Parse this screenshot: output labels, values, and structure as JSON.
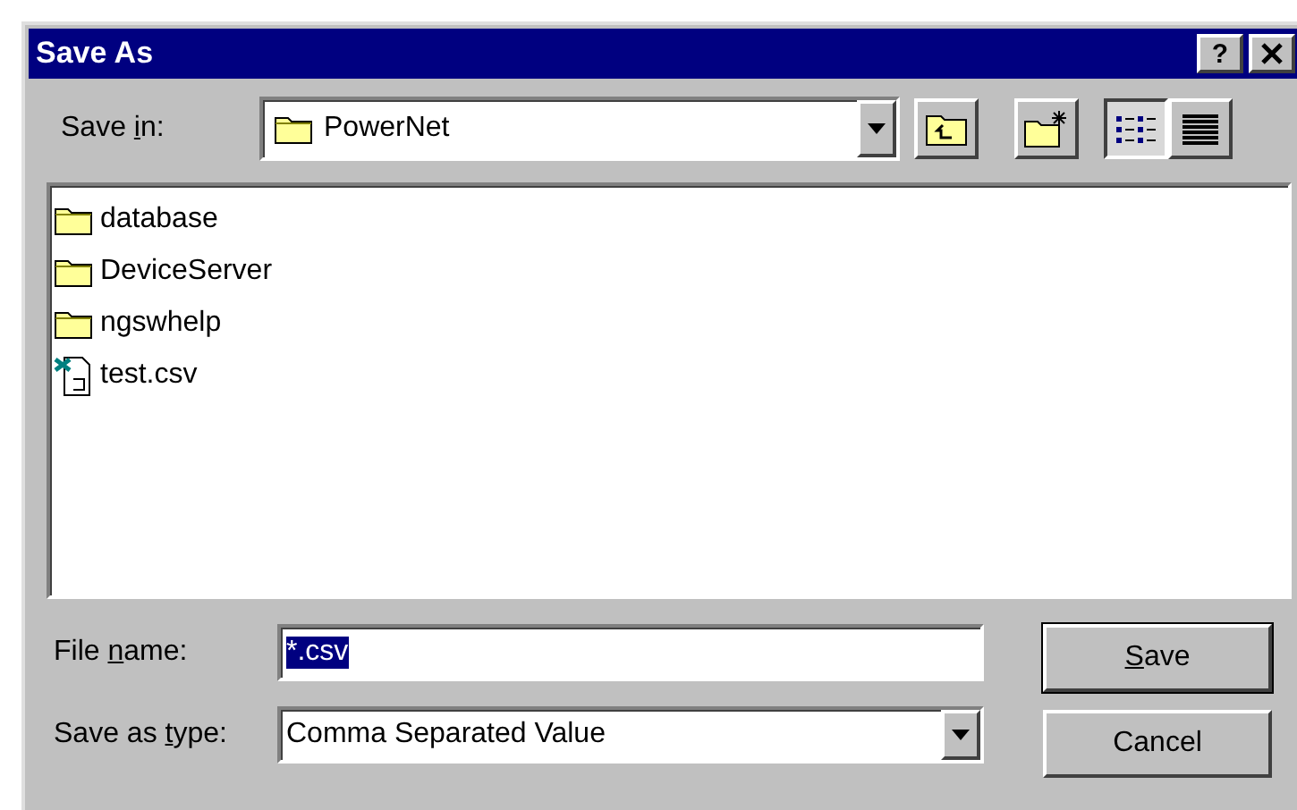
{
  "window": {
    "title": "Save As",
    "title_buttons": [
      "?"
    ]
  },
  "save_in": {
    "label": [
      "Save ",
      "i",
      "n:"
    ],
    "value": "PowerNet"
  },
  "toolbar": [
    {
      "kind": "up",
      "selected": false
    },
    {
      "kind": "new-folder",
      "selected": false
    },
    {
      "kind": "list",
      "selected": true
    },
    {
      "kind": "details",
      "selected": false
    }
  ],
  "files": [
    {
      "kind": "folder",
      "name": "database"
    },
    {
      "kind": "folder",
      "name": "DeviceServer"
    },
    {
      "kind": "folder",
      "name": "ngswhelp"
    },
    {
      "kind": "file",
      "name": "test.csv"
    }
  ],
  "file_name": {
    "label": [
      "File ",
      "n",
      "ame:"
    ],
    "value": "*.csv"
  },
  "save_as_type": {
    "label": [
      "Save as ",
      "t",
      "ype:"
    ],
    "value": "Comma Separated Value"
  },
  "buttons": [
    {
      "kind": "default",
      "label": {
        "key": "S",
        "after": "ave"
      }
    },
    {
      "kind": "normal",
      "label": {
        "after": "Cancel"
      }
    }
  ]
}
